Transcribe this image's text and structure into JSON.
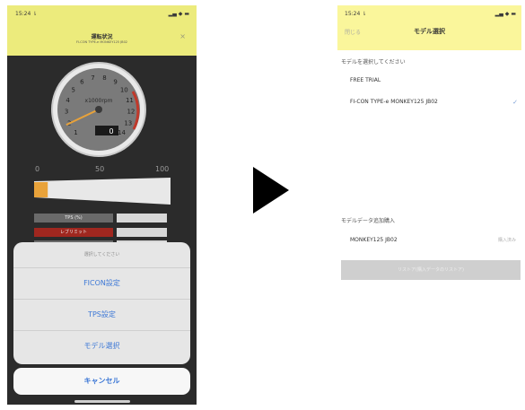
{
  "left_screen": {
    "status_time": "15:24 ⇂",
    "status_signal": "▂▄ ◆ ▬",
    "header_title": "運転状況",
    "header_subtitle": "FI-CON TYPE-e MONKEY125 JB02",
    "close_icon_glyph": "×",
    "gauge": {
      "unit_label": "x1000rpm",
      "ticks": [
        "1",
        "2",
        "3",
        "4",
        "5",
        "6",
        "7",
        "8",
        "9",
        "10",
        "11",
        "12",
        "13",
        "14"
      ],
      "needle_value": 0.5,
      "readout": "0"
    },
    "throttle_scale": [
      "0",
      "50",
      "100"
    ],
    "throttle_percent": 10,
    "indicators": [
      {
        "label": "TPS (%)",
        "color": "#6a6a6a"
      },
      {
        "label": "レブリミット",
        "color": "#a0271f"
      },
      {
        "label": "",
        "color": "#6a6a6a"
      }
    ],
    "action_sheet": {
      "title": "選択してください",
      "items": [
        "FICON設定",
        "TPS設定",
        "モデル選択"
      ],
      "cancel": "キャンセル"
    }
  },
  "right_screen": {
    "status_time": "15:24 ⇂",
    "status_signal": "▂▄ ◆ ▬",
    "close_label": "閉じる",
    "title": "モデル選択",
    "select_prompt": "モデルを選択してください",
    "models": [
      {
        "name": "FREE TRIAL",
        "checked": false
      },
      {
        "name": "FI-CON TYPE-e MONKEY125 JB02",
        "checked": true
      }
    ],
    "purchase_section_label": "モデルデータ追加購入",
    "purchase_items": [
      {
        "name": "MONKEY125 JB02",
        "status": "購入済み"
      }
    ],
    "restore_button": "リストア(購入データのリストア)"
  },
  "colors": {
    "left_header": "#eceb7c",
    "right_header": "#faf69b",
    "accent_blue": "#3d78d6",
    "throttle_fill": "#e8a23a"
  }
}
